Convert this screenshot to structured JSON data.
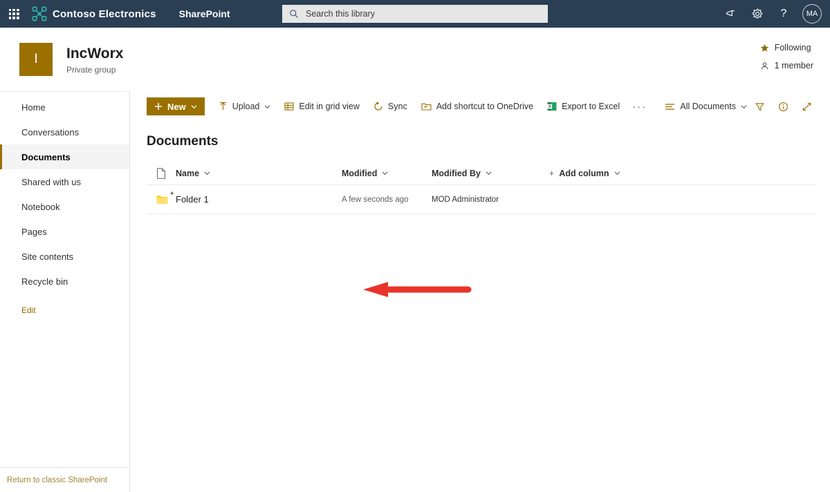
{
  "suitebar": {
    "waffle_label": "app-launcher",
    "brand": "Contoso Electronics",
    "app_name": "SharePoint",
    "search": {
      "placeholder": "Search this library",
      "value": ""
    },
    "icons": {
      "feedback": "megaphone-icon",
      "settings": "gear-icon",
      "help": "help-icon"
    },
    "avatar_initials": "MA"
  },
  "site": {
    "logo_letter": "I",
    "title": "IncWorx",
    "subtitle": "Private group",
    "following_label": "Following",
    "members_label": "1 member"
  },
  "sidebar": {
    "items": [
      {
        "label": "Home",
        "selected": false
      },
      {
        "label": "Conversations",
        "selected": false
      },
      {
        "label": "Documents",
        "selected": true
      },
      {
        "label": "Shared with us",
        "selected": false
      },
      {
        "label": "Notebook",
        "selected": false
      },
      {
        "label": "Pages",
        "selected": false
      },
      {
        "label": "Site contents",
        "selected": false
      },
      {
        "label": "Recycle bin",
        "selected": false
      }
    ],
    "edit_label": "Edit",
    "footer_link": "Return to classic SharePoint"
  },
  "toolbar": {
    "new_label": "New",
    "upload_label": "Upload",
    "grid_label": "Edit in grid view",
    "sync_label": "Sync",
    "shortcut_label": "Add shortcut to OneDrive",
    "excel_label": "Export to Excel",
    "overflow_label": "···",
    "view_label": "All Documents",
    "filter_label": "filter-icon",
    "info_label": "info-icon",
    "expand_label": "expand-icon"
  },
  "main": {
    "heading": "Documents",
    "columns": {
      "name": "Name",
      "modified": "Modified",
      "modified_by": "Modified By",
      "add_column": "Add column",
      "add_plus": "+"
    },
    "rows": [
      {
        "name": "Folder 1",
        "modified": "A few seconds ago",
        "modified_by": "MOD Administrator",
        "is_new": true
      }
    ]
  },
  "annotation": {
    "type": "arrow",
    "direction": "left",
    "color": "#e8342a",
    "points_at": "Folder 1"
  },
  "colors": {
    "suitebar_bg": "#2a3f54",
    "accent_gold": "#9a7000",
    "brand_teal": "#31b5ad",
    "annotation_red": "#e8342a"
  }
}
